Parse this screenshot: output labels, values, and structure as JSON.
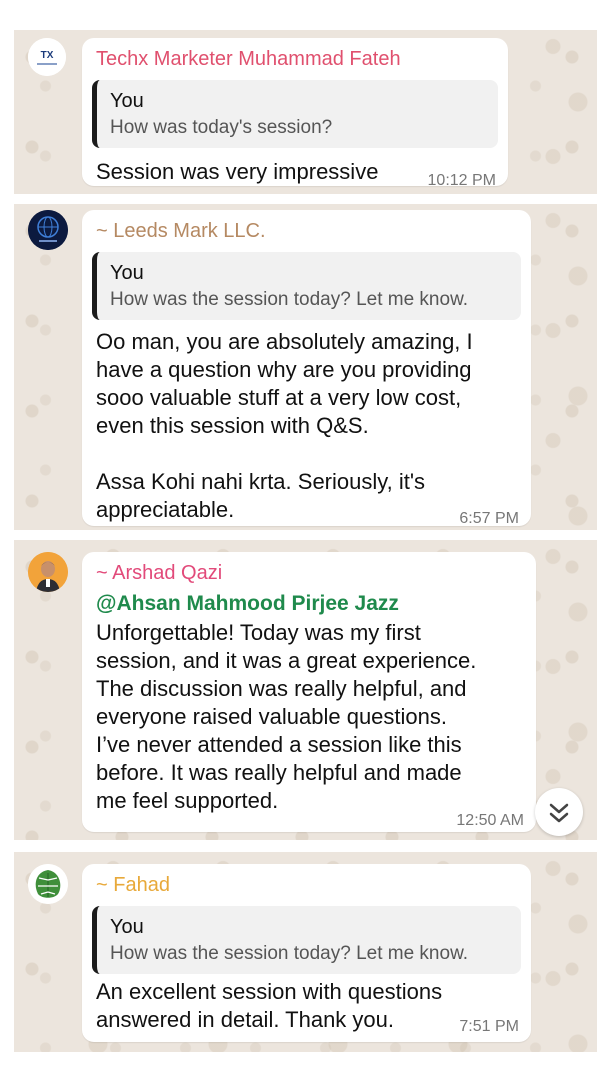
{
  "messages": [
    {
      "sender": "Techx Marketer Muhammad Fateh",
      "sender_color": "#e0506e",
      "quote_author": "You",
      "quote_text": "How was today's session?",
      "text": "Session was very impressive",
      "time": "10:12 PM"
    },
    {
      "sender": "~ Leeds Mark LLC.",
      "sender_color": "#b58962",
      "quote_author": "You",
      "quote_text": "How was the session today? Let me know.",
      "text_lines": [
        "Oo man, you are absolutely amazing, I",
        "have a question why are you providing",
        "sooo valuable stuff at a very low cost,",
        "even this session with Q&S.",
        "",
        "Assa Kohi nahi krta. Seriously, it's",
        "appreciatable."
      ],
      "time": "6:57 PM"
    },
    {
      "sender": "~ Arshad Qazi",
      "sender_color": "#e24a7a",
      "mention": "@Ahsan Mahmood Pirjee Jazz",
      "text_lines": [
        "Unforgettable! Today was my first",
        "session, and it was a great experience.",
        "The discussion was really helpful, and",
        "everyone raised valuable questions.",
        "I’ve never attended a session like this",
        "before. It was really helpful and made",
        "me feel supported."
      ],
      "time": "12:50 AM"
    },
    {
      "sender": "~ Fahad",
      "sender_color": "#e8a93a",
      "quote_author": "You",
      "quote_text": "How was the session today? Let me know.",
      "text_lines": [
        "An excellent session with questions",
        "answered in detail. Thank you."
      ],
      "time": "7:51 PM"
    }
  ],
  "icons": {
    "scroll_down": "chevron-double-down-icon"
  }
}
